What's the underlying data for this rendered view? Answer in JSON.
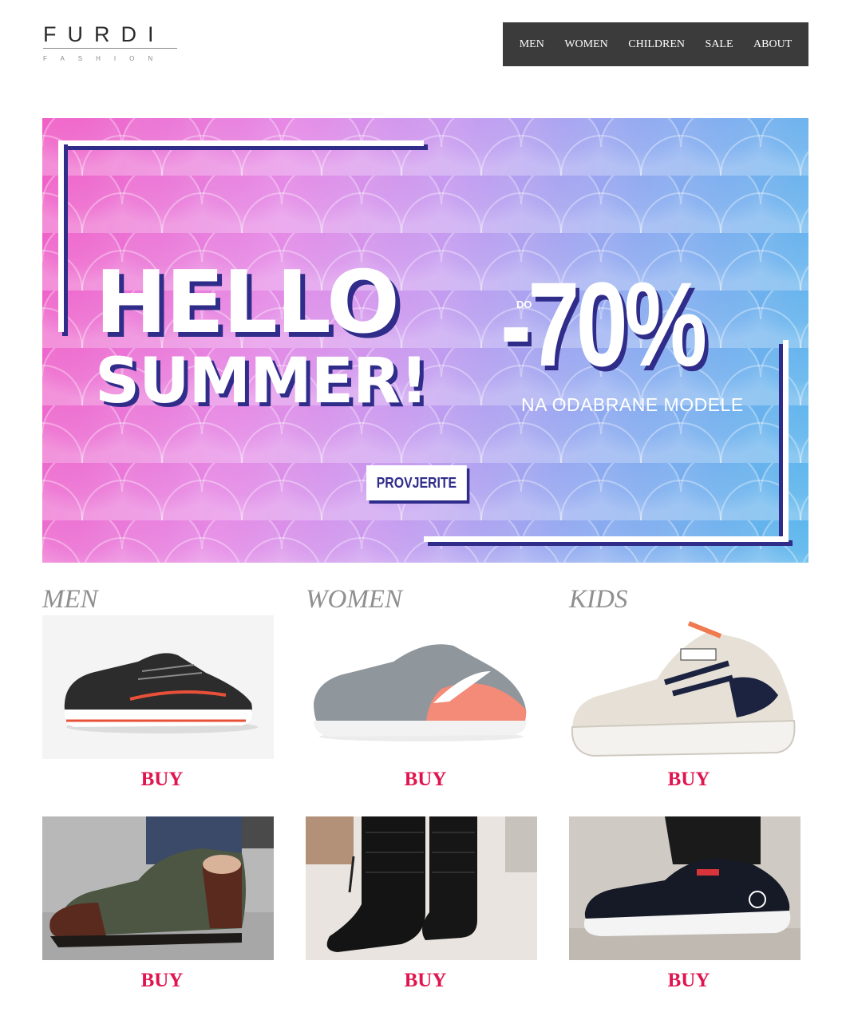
{
  "brand": {
    "name": "FURDI",
    "tagline": "FASHION"
  },
  "nav": {
    "items": [
      "MEN",
      "WOMEN",
      "CHILDREN",
      "SALE",
      "ABOUT"
    ]
  },
  "hero": {
    "headline_1": "HELLO",
    "headline_2": "SUMMER!",
    "prefix": "DO",
    "discount": "-70%",
    "subtitle": "NA ODABRANE MODELE",
    "cta_label": "PROVJERITE",
    "colors": {
      "frame_shadow": "#2f2c8a",
      "gradient_start": "#f05fc6",
      "gradient_end": "#58b6ec"
    }
  },
  "categories": [
    {
      "title": "MEN"
    },
    {
      "title": "WOMEN"
    },
    {
      "title": "KIDS"
    }
  ],
  "products": {
    "buy_label": "BUY",
    "items": [
      {
        "icon": "running-sneaker-black-icon"
      },
      {
        "icon": "running-sneaker-grey-coral-icon"
      },
      {
        "icon": "kids-sneaker-white-icon"
      },
      {
        "icon": "leather-boot-green-icon"
      },
      {
        "icon": "winter-boot-black-icon"
      },
      {
        "icon": "kids-sneaker-black-icon"
      }
    ]
  },
  "accent_color": "#e0154f"
}
